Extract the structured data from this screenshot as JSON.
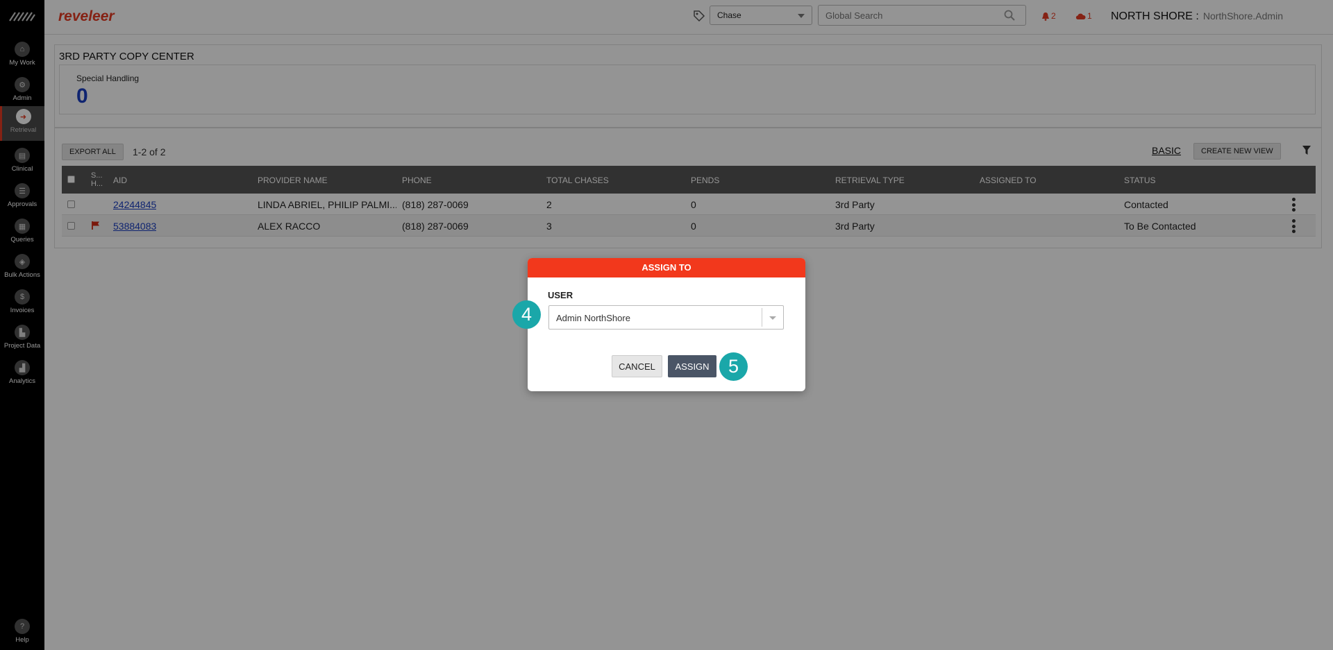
{
  "sidebar": {
    "items": [
      {
        "label": "My Work",
        "icon": "home-icon",
        "glyph": "⌂"
      },
      {
        "label": "Admin",
        "icon": "gear-icon",
        "glyph": "⚙"
      },
      {
        "label": "Retrieval",
        "icon": "arrow-right-icon",
        "glyph": "➜"
      },
      {
        "label": "Clinical",
        "icon": "clipboard-icon",
        "glyph": "▤"
      },
      {
        "label": "Approvals",
        "icon": "checklist-icon",
        "glyph": "☰"
      },
      {
        "label": "Queries",
        "icon": "document-icon",
        "glyph": "▦"
      },
      {
        "label": "Bulk Actions",
        "icon": "layers-icon",
        "glyph": "◈"
      },
      {
        "label": "Invoices",
        "icon": "dollar-icon",
        "glyph": "$"
      },
      {
        "label": "Project Data",
        "icon": "grid-icon",
        "glyph": "▙"
      },
      {
        "label": "Analytics",
        "icon": "chart-icon",
        "glyph": "▟"
      }
    ],
    "help_label": "Help",
    "help_glyph": "?"
  },
  "header": {
    "logo": "reveleer",
    "chase_select": "Chase",
    "search_placeholder": "Global Search",
    "notifications_count": "2",
    "cloud_count": "1",
    "org_name": "NORTH SHORE :",
    "user_name": "NorthShore.Admin"
  },
  "summary": {
    "title": "3RD PARTY COPY CENTER",
    "special_handling_label": "Special Handling",
    "special_handling_count": "0"
  },
  "grid": {
    "export_label": "EXPORT ALL",
    "count_text": "1-2  of  2",
    "basic_label": "BASIC",
    "create_view_label": "CREATE NEW VIEW",
    "columns": {
      "sh": "S... H...",
      "aid": "AID",
      "provider": "PROVIDER NAME",
      "phone": "PHONE",
      "total": "TOTAL CHASES",
      "pends": "PENDS",
      "retrieval": "RETRIEVAL TYPE",
      "assigned": "ASSIGNED TO",
      "status": "STATUS"
    },
    "rows": [
      {
        "aid": "24244845",
        "provider": "LINDA ABRIEL, PHILIP PALMI...",
        "phone": "(818) 287-0069",
        "total": "2",
        "pends": "0",
        "retrieval": "3rd Party",
        "assigned": "",
        "status": "Contacted"
      },
      {
        "aid": "53884083",
        "provider": "ALEX RACCO",
        "phone": "(818) 287-0069",
        "total": "3",
        "pends": "0",
        "retrieval": "3rd Party",
        "assigned": "",
        "status": "To Be Contacted"
      }
    ]
  },
  "modal": {
    "title": "ASSIGN TO",
    "user_label": "USER",
    "user_value": "Admin NorthShore",
    "cancel_label": "CANCEL",
    "assign_label": "ASSIGN"
  },
  "steps": {
    "user_step": "4",
    "assign_step": "5"
  },
  "colors": {
    "accent": "#e53b23",
    "modal_header": "#f2381c",
    "step_badge": "#1aa7a9",
    "link": "#1b3fc2"
  }
}
